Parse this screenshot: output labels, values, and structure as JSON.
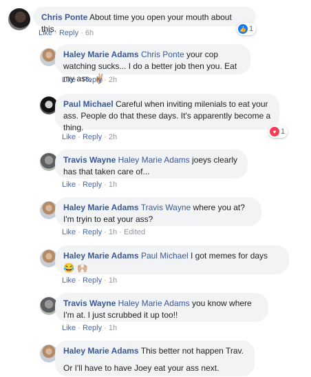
{
  "comments": [
    {
      "name": "Chris Ponte",
      "text": "About time you open your mouth about this.",
      "time": "6h",
      "reaction_count": "1"
    },
    {
      "name": "Haley Marie Adams",
      "tag": "Chris Ponte",
      "text": "your cop watching sucks... I do a better job then you. Eat my ass.",
      "emoji": "✌🏼",
      "time": "2h"
    },
    {
      "name": "Paul Michael",
      "text": "Careful when inviting milenials to eat your ass. People do that these days. It's apparently become a thing.",
      "time": "2h",
      "reaction_count": "1"
    },
    {
      "name": "Travis Wayne",
      "tag": "Haley Marie Adams",
      "text": "joeys clearly has that taken care of...",
      "time": "1h"
    },
    {
      "name": "Haley Marie Adams",
      "tag": "Travis Wayne",
      "text": "where you at? I'm tryin to eat your ass?",
      "time": "1h",
      "edited": "Edited"
    },
    {
      "name": "Haley Marie Adams",
      "tag": "Paul Michael",
      "text": "I got memes for days",
      "emoji": "😂",
      "emoji2": "🙌🏼",
      "time": "1h"
    },
    {
      "name": "Travis Wayne",
      "tag": "Haley Marie Adams",
      "text": "you know where I'm at. I just scrubbed it up too!!",
      "time": "1h"
    },
    {
      "name": "Haley Marie Adams",
      "text": "This better not happen Trav.",
      "text2": "Or I'll have to have Joey eat your ass next."
    }
  ],
  "labels": {
    "like": "Like",
    "reply": "Reply",
    "sep": "·"
  },
  "icons": {
    "like": "thumbs-up-icon",
    "love": "heart-icon"
  },
  "colors": {
    "name_link": "#385898",
    "action_link": "#4267b2",
    "bubble_bg": "#f2f3f5",
    "like_blue": "#1877f2",
    "love_red": "#f33e58"
  }
}
